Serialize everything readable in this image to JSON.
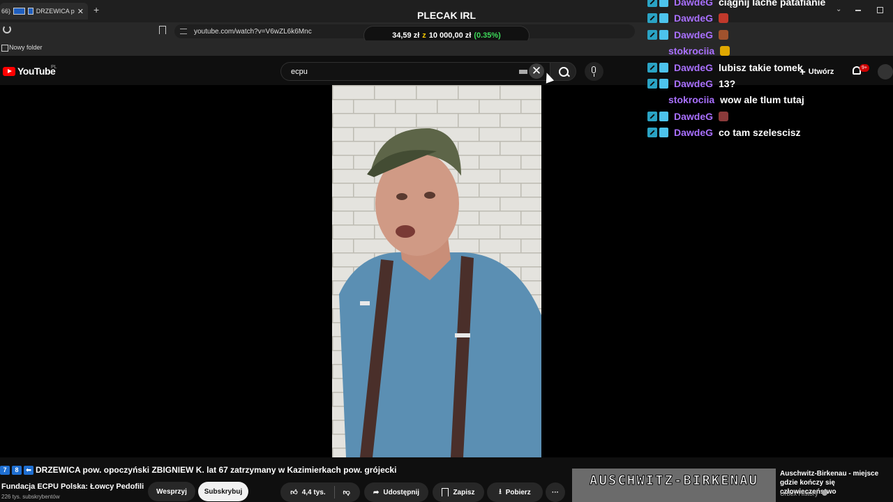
{
  "browser": {
    "tab_count_fragment": "66)",
    "tab_title": "DRZEWICA p",
    "url": "youtube.com/watch?v=V6wZL6k6Mnc",
    "bookmark_folder": "Nowy folder"
  },
  "stream": {
    "title": "PLECAK IRL",
    "donation_amount": "34,59 zł",
    "donation_of": "z",
    "donation_goal": "10 000,00 zł",
    "donation_percent": "(0.35%)"
  },
  "youtube": {
    "logo_text": "YouTube",
    "region": "PL",
    "search_value": "ecpu",
    "create_label": "Utwórz",
    "notifications_badge": "9+"
  },
  "video": {
    "title_prefix_keys": [
      "7",
      "8",
      "⬅"
    ],
    "title": "DRZEWICA pow. opoczyński ZBIGNIEW K. lat 67 zatrzymany w Kazimierkach pow. grójecki",
    "channel_name": "Fundacja ECPU Polska: Łowcy Pedofili",
    "channel_subs": "226 tys. subskrybentów",
    "join_label": "Wesprzyj",
    "subscribe_label": "Subskrybuj",
    "likes": "4,4 tys.",
    "share_label": "Udostępnij",
    "save_label": "Zapisz",
    "download_label": "Pobierz",
    "more_label": "···"
  },
  "recommended": {
    "thumb_text": "AUSCHWITZ-BIRKENAU",
    "title": "Auschwitz-Birkenau - miejsce gdzie kończy się człowieczeństwo",
    "channel": "Urbex History"
  },
  "chat": [
    {
      "user": "DawdeG",
      "message": "ciągnij lache patafianie",
      "badges": true,
      "emote": ""
    },
    {
      "user": "DawdeG",
      "message": "",
      "badges": true,
      "emote": "#c0392b"
    },
    {
      "user": "DawdeG",
      "message": "",
      "badges": true,
      "emote": "#a0522d"
    },
    {
      "user": "stokrociia",
      "message": "",
      "badges": false,
      "emote": "#e0a800"
    },
    {
      "user": "DawdeG",
      "message": "lubisz takie tomek",
      "badges": true,
      "emote": ""
    },
    {
      "user": "DawdeG",
      "message": "13?",
      "badges": true,
      "emote": ""
    },
    {
      "user": "stokrociia",
      "message": "wow ale tlum tutaj",
      "badges": false,
      "emote": ""
    },
    {
      "user": "DawdeG",
      "message": "",
      "badges": true,
      "emote": "#8b3a3a"
    },
    {
      "user": "DawdeG",
      "message": "co tam szelescisz",
      "badges": true,
      "emote": ""
    }
  ]
}
